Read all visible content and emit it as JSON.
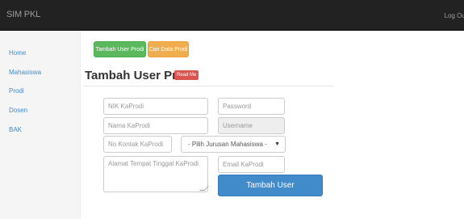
{
  "app": {
    "brand": "SIM PKL",
    "logout": "Log Out"
  },
  "sidebar": {
    "items": [
      {
        "label": "Home"
      },
      {
        "label": "Mahasiswa"
      },
      {
        "label": "Prodi"
      },
      {
        "label": "Dosen"
      },
      {
        "label": "BAK"
      }
    ]
  },
  "toolbar": {
    "add_label": "Tambah User Prodi",
    "search_label": "Cari Data Prodi"
  },
  "page": {
    "title": "Tambah User Prodi",
    "badge": "Read Me"
  },
  "form": {
    "nik_placeholder": "NIK KaProdi",
    "password_placeholder": "Password",
    "nama_placeholder": "Nama KaProdi",
    "username_placeholder": "Username",
    "kontak_placeholder": "No Kontak KaProdi",
    "jurusan_selected": "- Pilih Jurusan Mahasiswa -",
    "alamat_placeholder": "Alamat Tempat Tinggal KaProdi",
    "email_placeholder": "Email KaProdi",
    "submit_label": "Tambah User"
  },
  "colors": {
    "navbar": "#222222",
    "link": "#428bca",
    "success": "#5cb85c",
    "warning": "#f0ad4e",
    "danger": "#d9534f",
    "primary": "#428bca"
  }
}
